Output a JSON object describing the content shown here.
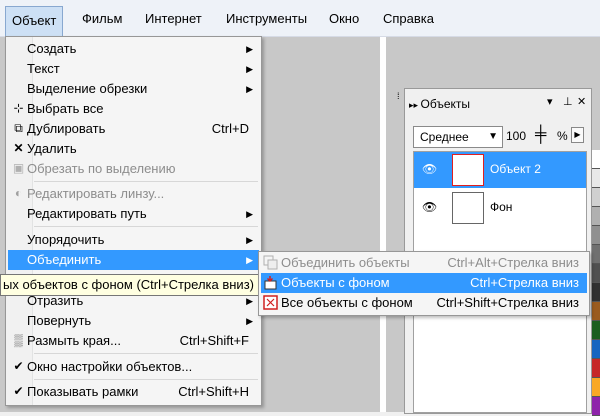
{
  "menubar": {
    "items": [
      "Объект",
      "Фильм",
      "Интернет",
      "Инструменты",
      "Окно",
      "Справка"
    ]
  },
  "menu": {
    "items": [
      {
        "label": "Создать",
        "shortcut": "",
        "submenu": true
      },
      {
        "label": "Текст",
        "shortcut": "",
        "submenu": true
      },
      {
        "label": "Выделение обрезки",
        "shortcut": "",
        "submenu": true
      },
      {
        "label": "Выбрать все",
        "shortcut": "",
        "icon": "select-all-icon"
      },
      {
        "label": "Дублировать",
        "shortcut": "Ctrl+D",
        "icon": "duplicate-icon"
      },
      {
        "label": "Удалить",
        "shortcut": "",
        "icon": "delete-x-icon"
      },
      {
        "label": "Обрезать по выделению",
        "shortcut": "",
        "icon": "crop-icon",
        "disabled": true
      },
      {
        "label": "Редактировать линзу...",
        "shortcut": "",
        "icon": "lens-icon",
        "disabled": true
      },
      {
        "label": "Редактировать путь",
        "shortcut": "",
        "submenu": true
      },
      {
        "label": "Упорядочить",
        "shortcut": "",
        "submenu": true
      },
      {
        "label": "Объединить",
        "shortcut": "",
        "submenu": true,
        "highlight": true
      },
      {
        "label": "Отразить",
        "shortcut": "",
        "submenu": true
      },
      {
        "label": "Повернуть",
        "shortcut": "",
        "submenu": true
      },
      {
        "label": "Размыть края...",
        "shortcut": "Ctrl+Shift+F",
        "icon": "blur-edges-icon"
      },
      {
        "label": "Окно настройки объектов...",
        "shortcut": "",
        "icon": "checkmark-icon"
      },
      {
        "label": "Показывать рамки",
        "shortcut": "Ctrl+Shift+H",
        "icon": "checkmark-icon"
      }
    ]
  },
  "tooltip": {
    "text": "ых объектов с фоном (Ctrl+Стрелка вниз)"
  },
  "submenu": {
    "items": [
      {
        "label": "Объединить объекты",
        "shortcut": "Ctrl+Alt+Стрелка вниз",
        "disabled": true
      },
      {
        "label": "Объекты с фоном",
        "shortcut": "Ctrl+Стрелка вниз",
        "highlight": true
      },
      {
        "label": "Все объекты с фоном",
        "shortcut": "Ctrl+Shift+Стрелка вниз"
      }
    ]
  },
  "panel": {
    "title": "Объекты",
    "blend_mode": "Среднее",
    "opacity": "100",
    "opacity_unit": "%",
    "layers": [
      {
        "name": "Объект 2",
        "selected": true
      },
      {
        "name": "Фон",
        "selected": false
      }
    ]
  },
  "colors": {
    "highlight": "#3399ff",
    "tooltip_bg": "#ffffe1",
    "palette": [
      "#ffffff",
      "#e8e8e8",
      "#d0d0d0",
      "#b0b0b0",
      "#909090",
      "#707070",
      "#505050",
      "#303030",
      "#9a5b1e",
      "#1b5e20",
      "#1565c0",
      "#c62828",
      "#f9a825",
      "#8e24aa"
    ]
  }
}
